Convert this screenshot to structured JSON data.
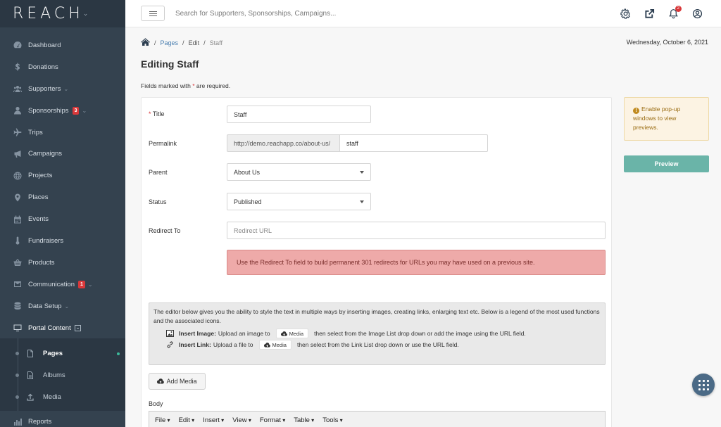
{
  "app": {
    "logo_text": "REACH",
    "logo_caret": "⌄"
  },
  "sidebar": {
    "items": [
      {
        "label": "Dashboard",
        "icon": "dashboard-icon"
      },
      {
        "label": "Donations",
        "icon": "dollar-icon"
      },
      {
        "label": "Supporters",
        "icon": "users-icon",
        "chevron": "⌄"
      },
      {
        "label": "Sponsorships",
        "icon": "user-icon",
        "badge": "3",
        "chevron": "⌄"
      },
      {
        "label": "Trips",
        "icon": "plane-icon"
      },
      {
        "label": "Campaigns",
        "icon": "megaphone-icon"
      },
      {
        "label": "Projects",
        "icon": "globe-icon"
      },
      {
        "label": "Places",
        "icon": "map-marker-icon"
      },
      {
        "label": "Events",
        "icon": "calendar-icon"
      },
      {
        "label": "Fundraisers",
        "icon": "thermometer-icon"
      },
      {
        "label": "Products",
        "icon": "basket-icon"
      },
      {
        "label": "Communication",
        "icon": "envelope-icon",
        "badge": "1",
        "chevron": "⌄"
      },
      {
        "label": "Data Setup",
        "icon": "database-icon",
        "chevron": "⌄"
      },
      {
        "label": "Portal Content",
        "icon": "monitor-icon"
      }
    ],
    "subitems": [
      {
        "label": "Pages",
        "icon": "page-icon"
      },
      {
        "label": "Albums",
        "icon": "album-icon"
      },
      {
        "label": "Media",
        "icon": "upload-icon"
      }
    ],
    "after": {
      "label": "Reports",
      "icon": "reports-icon"
    }
  },
  "topbar": {
    "search_placeholder": "Search for Supporters, Sponsorships, Campaigns...",
    "notifications_count": "2"
  },
  "breadcrumb": {
    "pages": "Pages",
    "edit": "Edit",
    "current": "Staff",
    "sep": "/"
  },
  "date": "Wednesday, October 6, 2021",
  "page": {
    "title": "Editing Staff",
    "required_note_pre": "Fields marked with",
    "required_star": "*",
    "required_note_post": "are required."
  },
  "form": {
    "title_label": "Title",
    "title_star": "*",
    "title_value": "Staff",
    "permalink_label": "Permalink",
    "permalink_prefix": "http://demo.reachapp.co/about-us/",
    "permalink_value": "staff",
    "parent_label": "Parent",
    "parent_value": "About Us",
    "status_label": "Status",
    "status_value": "Published",
    "redirect_label": "Redirect To",
    "redirect_placeholder": "Redirect URL",
    "redirect_alert": "Use the Redirect To field to build permanent 301 redirects for URLs you may have used on a previous site."
  },
  "legend": {
    "intro": "The editor below gives you the ability to style the text in multiple ways by inserting images, creating links, enlarging text etc. Below is a legend of the most used functions and the associated icons.",
    "image_title": "Insert Image:",
    "image_pre": "Upload an image to",
    "image_post": "then select from the Image List drop down or add the image using the URL field.",
    "link_title": "Insert Link:",
    "link_pre": "Upload a file to",
    "link_post": "then select from the Link List drop down or use the URL field.",
    "media_chip": "Media"
  },
  "add_media_label": "Add Media",
  "body_label": "Body",
  "editor_menu": [
    "File",
    "Edit",
    "Insert",
    "View",
    "Format",
    "Table",
    "Tools"
  ],
  "side": {
    "warning": "Enable pop-up windows to view previews.",
    "warning_icon": "!",
    "preview_label": "Preview"
  }
}
